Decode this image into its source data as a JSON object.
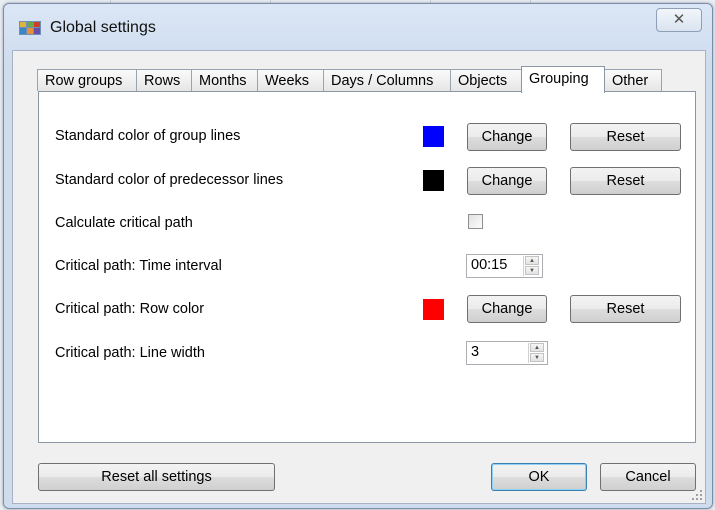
{
  "window": {
    "title": "Global settings",
    "close_glyph": "✕"
  },
  "tabs": [
    {
      "label": "Row groups",
      "active": false
    },
    {
      "label": "Rows",
      "active": false
    },
    {
      "label": "Months",
      "active": false
    },
    {
      "label": "Weeks",
      "active": false
    },
    {
      "label": "Days / Columns",
      "active": false
    },
    {
      "label": "Objects",
      "active": false
    },
    {
      "label": "Grouping",
      "active": true
    },
    {
      "label": "Other",
      "active": false
    }
  ],
  "settings": {
    "group_lines": {
      "label": "Standard color of group lines",
      "color": "#0000ff",
      "change_label": "Change",
      "reset_label": "Reset"
    },
    "predecessor_lines": {
      "label": "Standard color of predecessor lines",
      "color": "#000000",
      "change_label": "Change",
      "reset_label": "Reset"
    },
    "critical_path": {
      "label": "Calculate critical path",
      "checked": false
    },
    "time_interval": {
      "label": "Critical path: Time interval",
      "value": "00:15"
    },
    "row_color": {
      "label": "Critical path: Row color",
      "color": "#ff0000",
      "change_label": "Change",
      "reset_label": "Reset"
    },
    "line_width": {
      "label": "Critical path: Line width",
      "value": "3"
    }
  },
  "footer": {
    "reset_all_label": "Reset all settings",
    "ok_label": "OK",
    "cancel_label": "Cancel"
  },
  "icons": {
    "app": "app-palette-icon",
    "close": "close-icon",
    "spin_up": "spin-up-icon",
    "spin_down": "spin-down-icon",
    "resize": "resize-grip-icon"
  }
}
